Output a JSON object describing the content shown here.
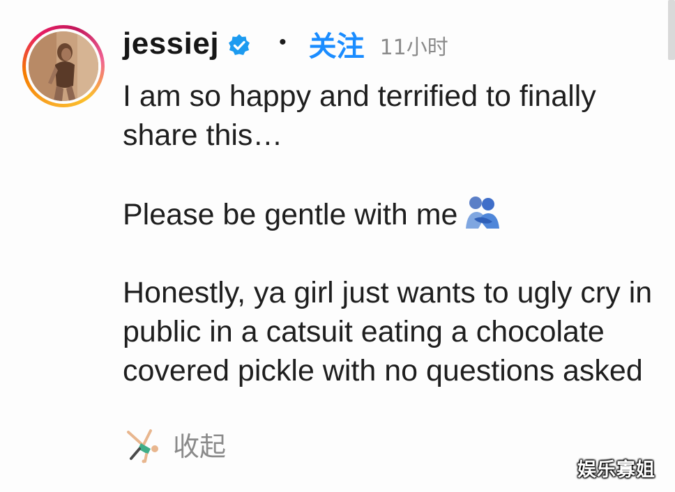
{
  "post": {
    "username": "jessiej",
    "follow_label": "关注",
    "separator": "•",
    "timestamp": "11小时",
    "avatar_icon": "profile-photo",
    "verified_icon": "verified-badge-icon",
    "caption": {
      "line1": "I am so happy and terrified to finally share this…",
      "line2": "Please be gentle with me",
      "line2_emoji": "people-hugging-icon",
      "line3": "Honestly, ya girl just wants to ugly cry in public in a catsuit eating a chocolate covered pickle with no questions asked"
    },
    "collapse_emoji": "person-cartwheeling-icon",
    "collapse_label": "收起"
  },
  "watermark": "娱乐寡姐",
  "colors": {
    "accent": "#1a8cff",
    "muted": "#8a8a8a",
    "text": "#1e1e1e",
    "verified": "#1d9bf0",
    "ring_start": "#f9a825",
    "ring_end": "#e91e63"
  }
}
